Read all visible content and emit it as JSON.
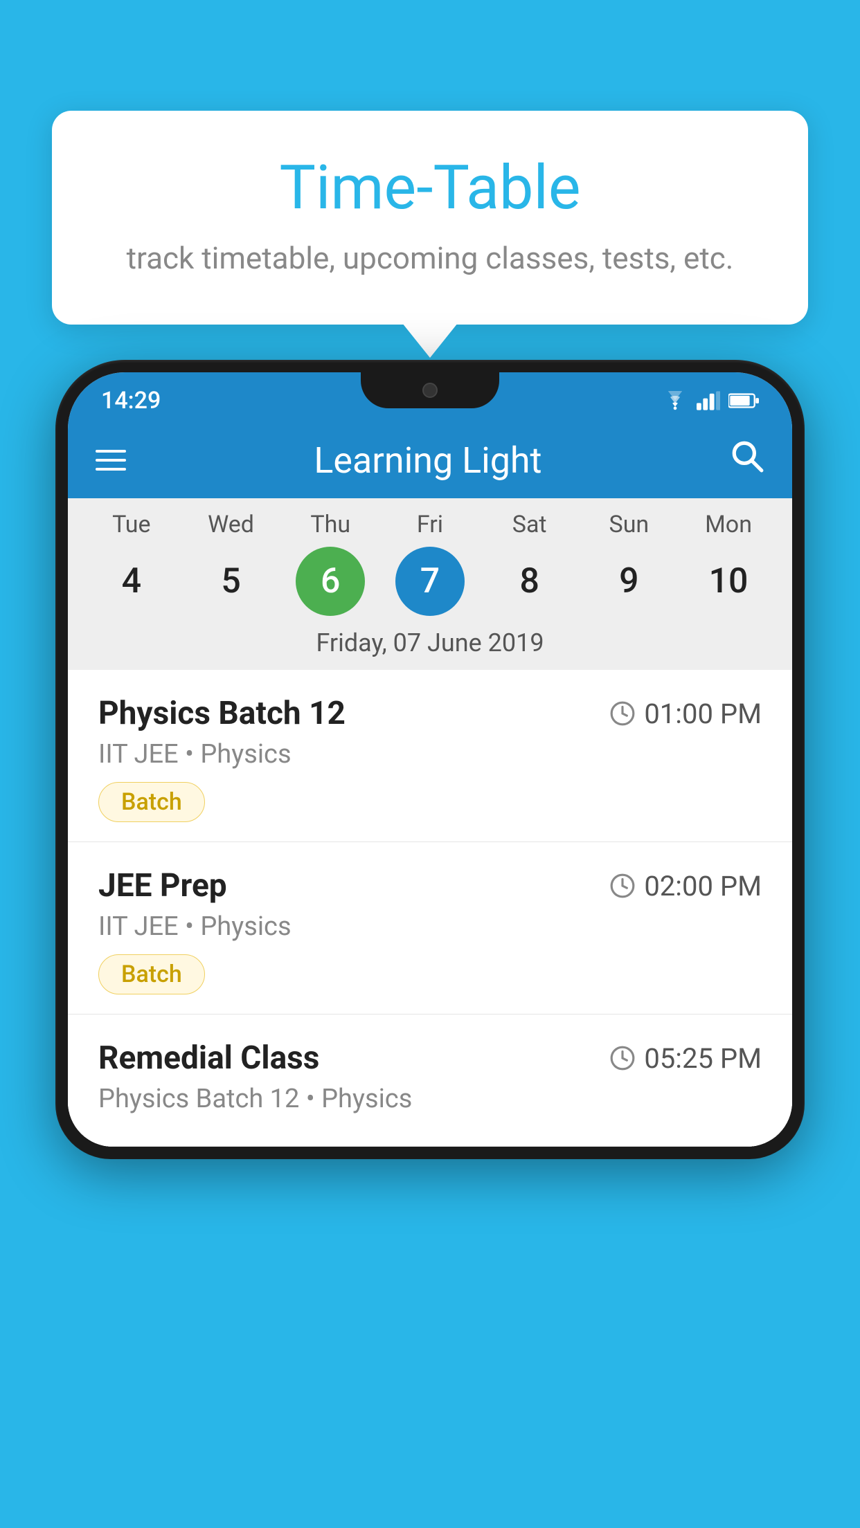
{
  "background_color": "#29b6e8",
  "tooltip": {
    "title": "Time-Table",
    "subtitle": "track timetable, upcoming classes, tests, etc."
  },
  "phone": {
    "status_bar": {
      "time": "14:29"
    },
    "toolbar": {
      "title": "Learning Light"
    },
    "calendar": {
      "days": [
        {
          "label": "Tue",
          "num": "4"
        },
        {
          "label": "Wed",
          "num": "5"
        },
        {
          "label": "Thu",
          "num": "6",
          "state": "today"
        },
        {
          "label": "Fri",
          "num": "7",
          "state": "selected"
        },
        {
          "label": "Sat",
          "num": "8"
        },
        {
          "label": "Sun",
          "num": "9"
        },
        {
          "label": "Mon",
          "num": "10"
        }
      ],
      "selected_date_label": "Friday, 07 June 2019"
    },
    "schedule": [
      {
        "title": "Physics Batch 12",
        "time": "01:00 PM",
        "sub": "IIT JEE • Physics",
        "badge": "Batch"
      },
      {
        "title": "JEE Prep",
        "time": "02:00 PM",
        "sub": "IIT JEE • Physics",
        "badge": "Batch"
      },
      {
        "title": "Remedial Class",
        "time": "05:25 PM",
        "sub": "Physics Batch 12 • Physics",
        "badge": null
      }
    ]
  }
}
